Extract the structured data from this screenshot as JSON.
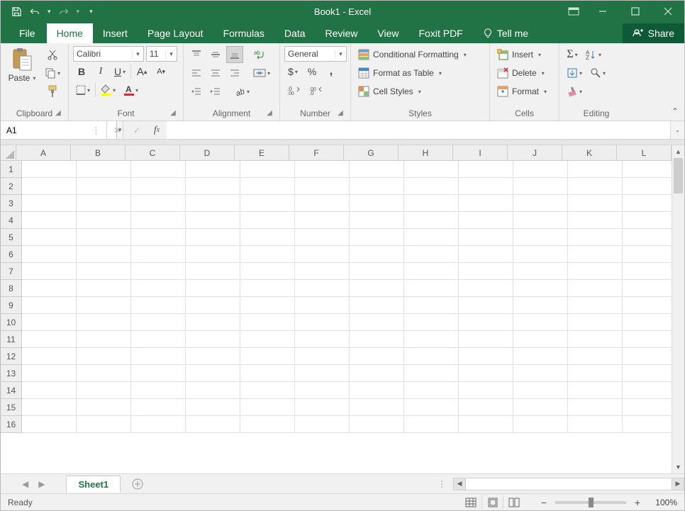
{
  "title": "Book1 - Excel",
  "tabs": {
    "file": "File",
    "list": [
      "Home",
      "Insert",
      "Page Layout",
      "Formulas",
      "Data",
      "Review",
      "View",
      "Foxit PDF"
    ],
    "active": "Home",
    "tellme": "Tell me",
    "share": "Share"
  },
  "ribbon": {
    "clipboard": {
      "label": "Clipboard",
      "paste": "Paste"
    },
    "font": {
      "label": "Font",
      "name": "Calibri",
      "size": "11",
      "bold": "B",
      "italic": "I",
      "underline": "U",
      "increase": "A",
      "decrease": "A"
    },
    "alignment": {
      "label": "Alignment"
    },
    "number": {
      "label": "Number",
      "format": "General",
      "currency": "$",
      "percent": "%",
      "comma": ",",
      "inc": ".00",
      "dec": ".00"
    },
    "styles": {
      "label": "Styles",
      "conditional": "Conditional Formatting",
      "table": "Format as Table",
      "cell": "Cell Styles"
    },
    "cells": {
      "label": "Cells",
      "insert": "Insert",
      "delete": "Delete",
      "format": "Format"
    },
    "editing": {
      "label": "Editing"
    }
  },
  "formula_bar": {
    "name_box": "A1",
    "formula": ""
  },
  "grid": {
    "columns": [
      "A",
      "B",
      "C",
      "D",
      "E",
      "F",
      "G",
      "H",
      "I",
      "J",
      "K",
      "L"
    ],
    "rows": [
      1,
      2,
      3,
      4,
      5,
      6,
      7,
      8,
      9,
      10,
      11,
      12,
      13,
      14,
      15,
      16
    ]
  },
  "sheet_tabs": {
    "active": "Sheet1"
  },
  "status": {
    "ready": "Ready",
    "zoom": "100%"
  }
}
